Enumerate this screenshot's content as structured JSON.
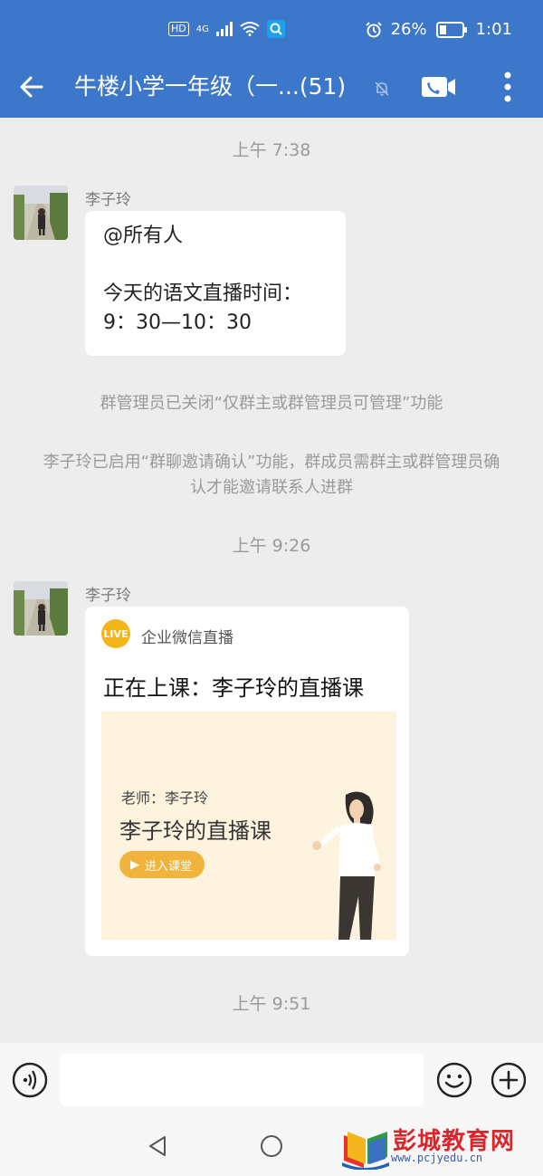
{
  "status_bar": {
    "network_badge": "HD",
    "network_type": "4G",
    "battery_percent": "26%",
    "time": "1:01"
  },
  "header": {
    "title": "牛楼小学一年级（一...(51)",
    "colors": {
      "bar": "#3C77C9"
    }
  },
  "messages": [
    {
      "time": "上午 7:38"
    },
    {
      "sender": "李子玲",
      "lines": "@所有人\n\n今天的语文直播时间：\n9：30—10：30"
    },
    {
      "system": "群管理员已关闭“仅群主或群管理员可管理”功能"
    },
    {
      "system": "李子玲已启用“群聊邀请确认”功能，群成员需群主或群管理员确认才能邀请联系人进群"
    },
    {
      "time": "上午 9:26"
    },
    {
      "sender": "李子玲",
      "card": {
        "logo_text": "LIVE",
        "source": "企业微信直播",
        "title": "正在上课：李子玲的直播课",
        "banner_teacher": "老师：李子玲",
        "banner_course": "李子玲的直播课",
        "enter_button": "进入课堂"
      }
    },
    {
      "time": "上午 9:51"
    }
  ],
  "input_bar": {
    "text_value": "",
    "icons": [
      "voice-icon",
      "emoji-icon",
      "plus-icon"
    ]
  },
  "nav_bar": {
    "icons": [
      "nav-back-icon",
      "nav-home-icon"
    ]
  },
  "watermark": {
    "title": "彭城教育网",
    "url": "www.pcjyedu.cn"
  }
}
